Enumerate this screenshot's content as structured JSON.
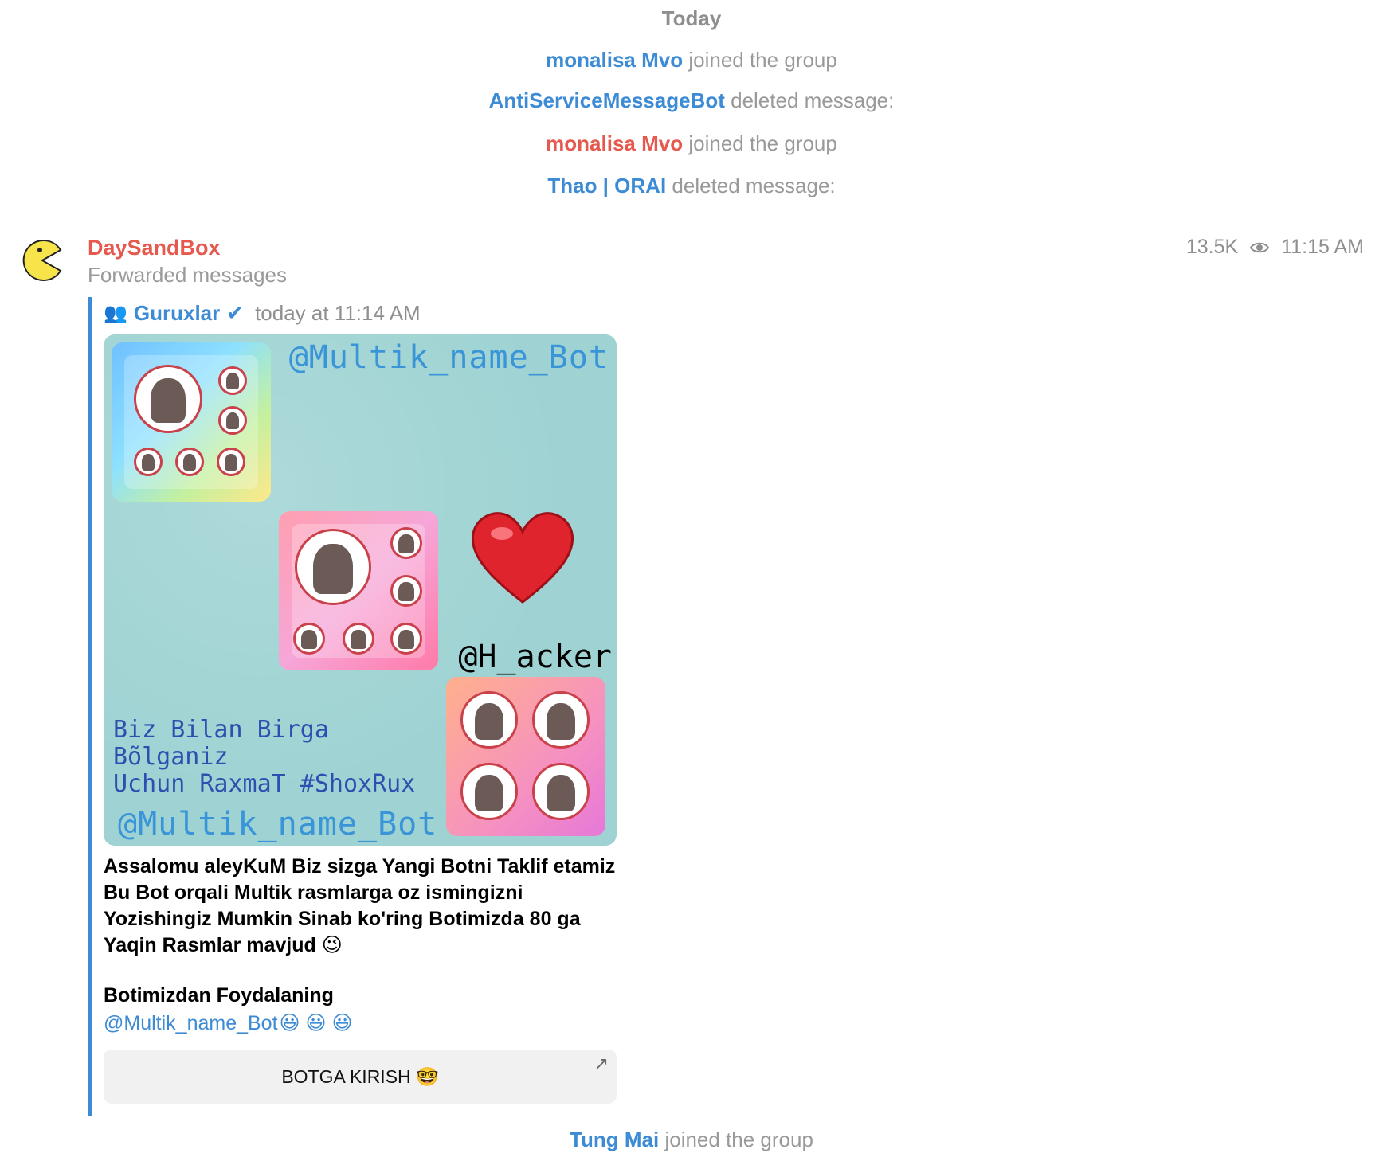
{
  "date_header": "Today",
  "service_messages": [
    {
      "name": "monalisa Mvo",
      "text": "joined the group",
      "color": "#3c8bd4"
    },
    {
      "name": "AntiServiceMessageBot",
      "text": "deleted message:",
      "color": "#3c8bd4"
    },
    {
      "name": "monalisa Mvo",
      "text": "joined the group",
      "color": "#e5594f"
    },
    {
      "name": "Thao | ORAI",
      "text": "deleted message:",
      "color": "#3c8bd4"
    }
  ],
  "post": {
    "sender": "DaySandBox",
    "forwarded_label": "Forwarded messages",
    "views": "13.5K",
    "time": "11:15 AM",
    "forward": {
      "group_icon": "👥",
      "group_name": "Guruxlar",
      "verified": "✔",
      "time": "today at 11:14 AM"
    },
    "image": {
      "watermark_top": "@Multik_name_Bot",
      "watermark_bottom": "@Multik_name_Bot",
      "handle": "@H_acker",
      "thanks_line1": "Biz Bilan Birga Bõlganiz",
      "thanks_line2": "Uchun RaxmaT #ShoxRux"
    },
    "text_line1": "Assalomu aleyKuM Biz sizga Yangi Botni Taklif etamiz Bu Bot orqali Multik rasmlarga oz ismingizni Yozishingiz Mumkin Sinab ko'ring Botimizda 80 ga Yaqin Rasmlar mavjud 😉",
    "text_line2": "Botimizdan Foydalaning",
    "link": "@Multik_name_Bot",
    "link_emojis": "😃 😃 😃",
    "button_label": "BOTGA KIRISH 🤓",
    "button_arrow": "↗"
  },
  "bottom_service": {
    "name": "Tung Mai",
    "text": "joined the group",
    "color": "#3c8bd4"
  }
}
